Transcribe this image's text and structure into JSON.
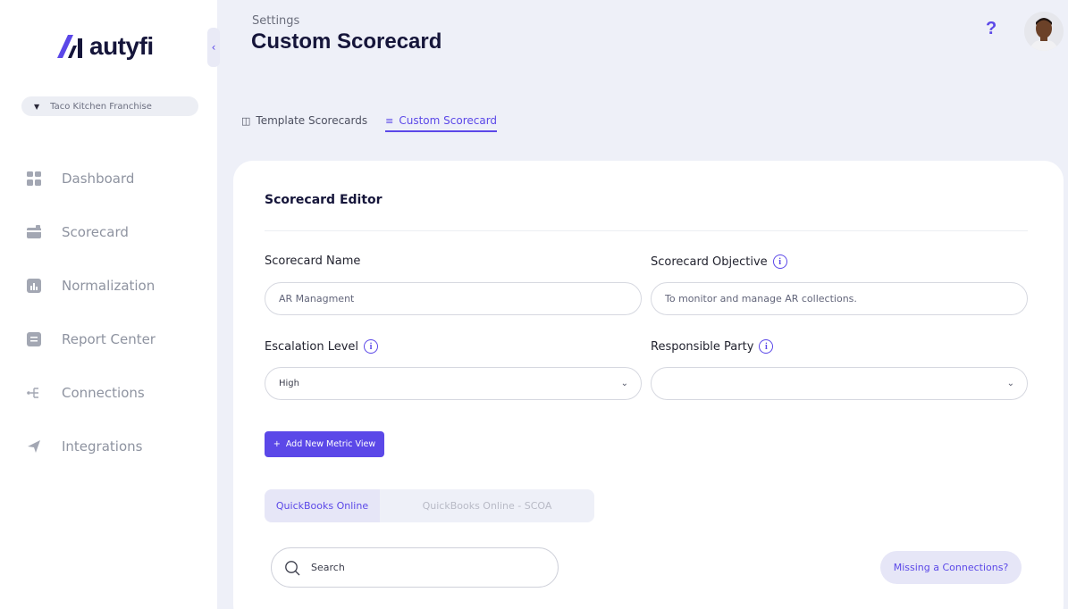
{
  "brand": {
    "name": "autyfi",
    "accent": "#5b48e8"
  },
  "sidebar": {
    "org_selector": "Taco Kitchen Franchise",
    "items": [
      {
        "label": "Dashboard",
        "icon": "dashboard-icon"
      },
      {
        "label": "Scorecard",
        "icon": "scorecard-icon"
      },
      {
        "label": "Normalization",
        "icon": "normalization-icon"
      },
      {
        "label": "Report Center",
        "icon": "report-center-icon"
      },
      {
        "label": "Connections",
        "icon": "connections-icon"
      },
      {
        "label": "Integrations",
        "icon": "integrations-icon"
      }
    ]
  },
  "header": {
    "breadcrumb": "Settings",
    "title": "Custom Scorecard",
    "help_label": "?"
  },
  "tabs": [
    {
      "label": "Template Scorecards",
      "active": false
    },
    {
      "label": "Custom Scorecard",
      "active": true
    }
  ],
  "editor": {
    "title": "Scorecard Editor",
    "scorecard_name": {
      "label": "Scorecard Name",
      "value": "AR Managment"
    },
    "scorecard_objective": {
      "label": "Scorecard Objective",
      "value": "To monitor and manage AR collections."
    },
    "escalation_level": {
      "label": "Escalation Level",
      "value": "High"
    },
    "responsible_party": {
      "label": "Responsible Party",
      "value": ""
    },
    "add_metric_label": "Add New Metric View",
    "sources": [
      {
        "label": "QuickBooks Online",
        "active": true
      },
      {
        "label": "QuickBooks Online - SCOA",
        "active": false
      }
    ],
    "search_placeholder": "Search",
    "missing_connections_label": "Missing a Connections?"
  }
}
